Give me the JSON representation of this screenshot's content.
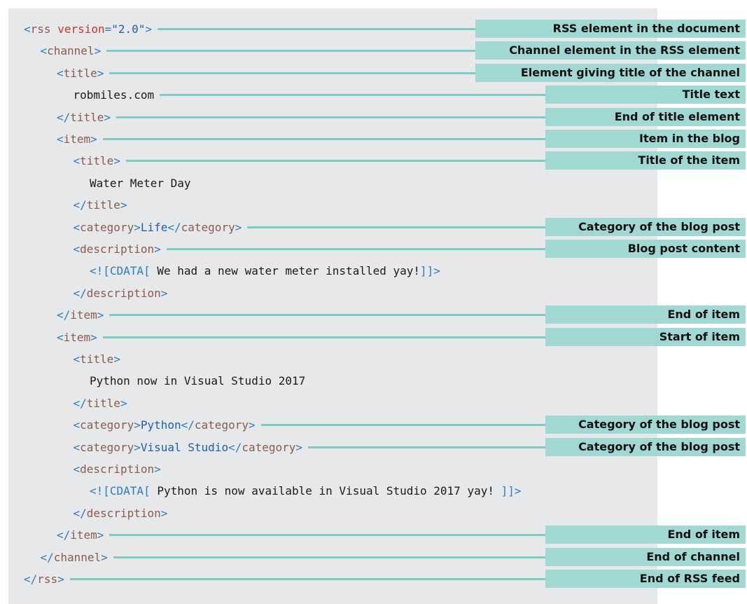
{
  "colors": {
    "panel": "#e7e8ea",
    "label_fill": "#a2d8d3",
    "leader_line": "#7ecbc6",
    "bracket": "#2e7db8",
    "tag_name": "#8a5b4e",
    "attribute": "#c0392b",
    "value": "#1f5fae",
    "text": "#1a1a1a"
  },
  "lines": [
    {
      "tokens": [
        "<",
        "rss",
        " ",
        "version",
        "=",
        "\"2.0\"",
        ">"
      ],
      "label": "RSS element in the document"
    },
    {
      "tokens": [
        "<",
        "channel",
        ">"
      ],
      "label": "Channel element in the RSS element"
    },
    {
      "tokens": [
        "<",
        "title",
        ">"
      ],
      "label": "Element giving title of the channel"
    },
    {
      "tokens": [
        "robmiles.com"
      ],
      "label": "Title text"
    },
    {
      "tokens": [
        "</",
        "title",
        ">"
      ],
      "label": "End of title element"
    },
    {
      "tokens": [
        "<",
        "item",
        ">"
      ],
      "label": "Item in the blog"
    },
    {
      "tokens": [
        "<",
        "title",
        ">"
      ],
      "label": "Title of the item"
    },
    {
      "tokens": [
        "Water Meter Day"
      ]
    },
    {
      "tokens": [
        "</",
        "title",
        ">"
      ]
    },
    {
      "tokens": [
        "<",
        "category",
        ">",
        "Life",
        "</",
        "category",
        ">"
      ],
      "label": "Category of the blog post"
    },
    {
      "tokens": [
        "<",
        "description",
        ">"
      ],
      "label": "Blog post content"
    },
    {
      "tokens": [
        "<![CDATA[",
        " We had a new water meter installed yay!",
        "]]>"
      ]
    },
    {
      "tokens": [
        "</",
        "description",
        ">"
      ]
    },
    {
      "tokens": [
        "</",
        "item",
        ">"
      ],
      "label": "End of item"
    },
    {
      "tokens": [
        "<",
        "item",
        ">"
      ],
      "label": "Start of item"
    },
    {
      "tokens": [
        "<",
        "title",
        ">"
      ]
    },
    {
      "tokens": [
        "Python now in Visual Studio 2017"
      ]
    },
    {
      "tokens": [
        "</",
        "title",
        ">"
      ]
    },
    {
      "tokens": [
        "<",
        "category",
        ">",
        "Python",
        "</",
        "category",
        ">"
      ],
      "label": "Category of the blog post"
    },
    {
      "tokens": [
        "<",
        "category",
        ">",
        "Visual Studio",
        "</",
        "category",
        ">"
      ],
      "label": "Category of the blog post"
    },
    {
      "tokens": [
        "<",
        "description",
        ">"
      ]
    },
    {
      "tokens": [
        "<![CDATA[",
        " Python is now available in Visual Studio 2017 yay! ",
        "]]>"
      ]
    },
    {
      "tokens": [
        "</",
        "description",
        ">"
      ]
    },
    {
      "tokens": [
        "</",
        "item",
        ">"
      ],
      "label": "End of item"
    },
    {
      "tokens": [
        "</",
        "channel",
        ">"
      ],
      "label": "End of channel"
    },
    {
      "tokens": [
        "</",
        "rss",
        ">"
      ],
      "label": "End of RSS feed"
    }
  ]
}
